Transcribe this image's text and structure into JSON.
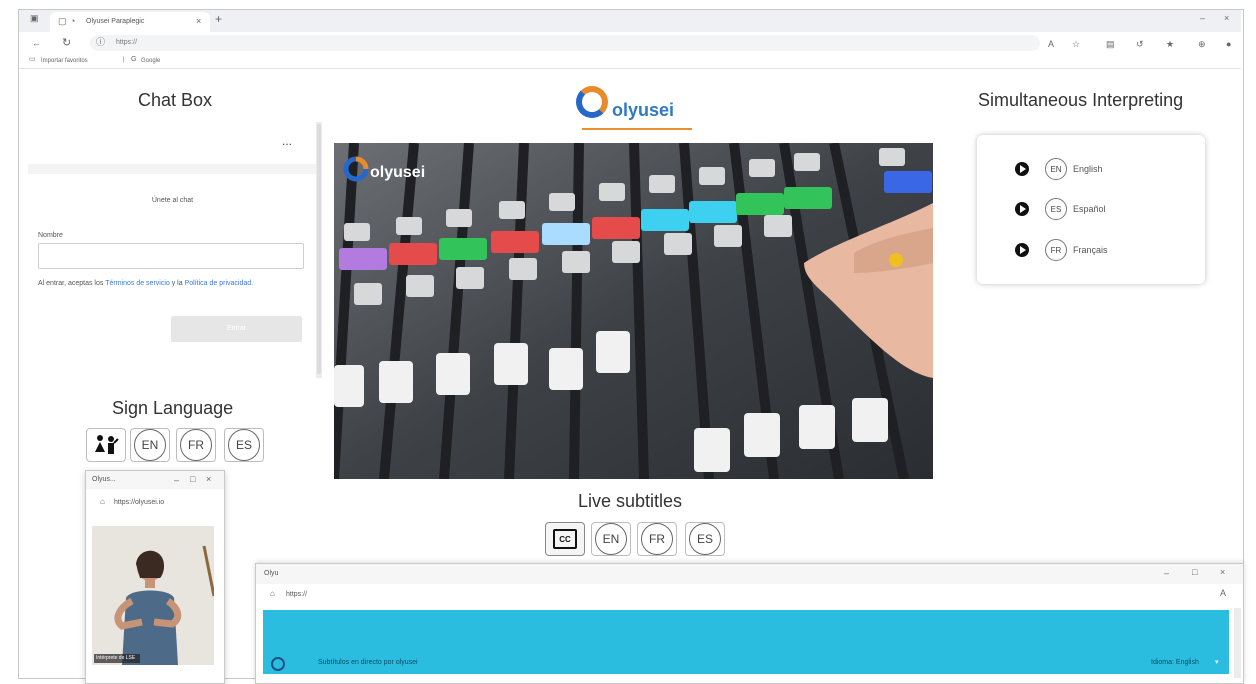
{
  "browser": {
    "tab_title": "Olyusei Paraplegic",
    "new_tab": "+",
    "url": "https://",
    "bookmarks": [
      "Importar favoritos",
      "Google"
    ]
  },
  "chat": {
    "title": "Chat Box",
    "menu": "...",
    "welcome": "Únete al chat",
    "name_label": "Nombre",
    "consent_prefix": "Al entrar, aceptas los",
    "terms_link": "Términos de servicio",
    "consent_mid": "y la",
    "privacy_link": "Política de privacidad.",
    "send_button": "Entrar"
  },
  "logo": {
    "text": "olyusei",
    "color_primary": "#2568c9",
    "color_accent": "#e98a2b"
  },
  "video": {
    "watermark": "olyusei"
  },
  "interpreting": {
    "title": "Simultaneous Interpreting",
    "languages": [
      {
        "code": "EN",
        "name": "English"
      },
      {
        "code": "ES",
        "name": "Español"
      },
      {
        "code": "FR",
        "name": "Français"
      }
    ]
  },
  "sign_language": {
    "title": "Sign Language",
    "icon": "sign-language-icon",
    "languages": [
      "EN",
      "FR",
      "ES"
    ],
    "popup": {
      "title": "Olyus...",
      "url": "https://olyusei.io",
      "video_caption": "Intérprete de LSE"
    }
  },
  "subtitles": {
    "title": "Live subtitles",
    "icon": "cc-icon",
    "cc_label": "CC",
    "languages": [
      "EN",
      "FR",
      "ES"
    ]
  },
  "subtitle_window": {
    "title": "Olyu",
    "url": "https://",
    "bar_text": "Subtítulos en directo por olyusei",
    "bar_select": "Idioma: English",
    "bar_color": "#2bbde0"
  }
}
